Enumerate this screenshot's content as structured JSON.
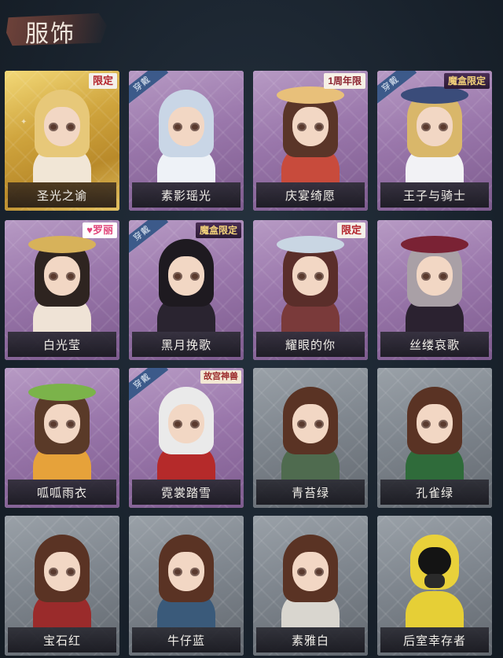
{
  "header": {
    "title": "服饰"
  },
  "outfits": [
    {
      "name": "圣光之谕",
      "frame": "gold",
      "badge_wear": "",
      "badge": "限定",
      "badge_style": "limited",
      "hair": "#e7c879",
      "body": "#f1e6d6",
      "hat": ""
    },
    {
      "name": "素影瑶光",
      "frame": "purple",
      "badge_wear": "穿戴",
      "badge": "",
      "badge_style": "",
      "hair": "#c9d6e6",
      "body": "#eef2f7",
      "hat": ""
    },
    {
      "name": "庆宴绮愿",
      "frame": "purple",
      "badge_wear": "",
      "badge": "1周年限",
      "badge_style": "anniv",
      "hair": "#5a3528",
      "body": "#c84b3c",
      "hat": "#e8c07a"
    },
    {
      "name": "王子与骑士",
      "frame": "gold-purple",
      "badge_wear": "穿戴",
      "badge": "魔盒限定",
      "badge_style": "box",
      "hair": "#d9b76a",
      "body": "#f2f2f5",
      "hat": "#3a4c7a"
    },
    {
      "name": "白光莹",
      "frame": "purple",
      "badge_wear": "",
      "badge": "♥罗丽",
      "badge_style": "love",
      "hair": "#2e2420",
      "body": "#efe3d6",
      "hat": "#d7b25a"
    },
    {
      "name": "黑月挽歌",
      "frame": "gold-purple",
      "badge_wear": "穿戴",
      "badge": "魔盒限定",
      "badge_style": "box",
      "hair": "#1e1a20",
      "body": "#2a2430",
      "hat": ""
    },
    {
      "name": "耀眼的你",
      "frame": "purple",
      "badge_wear": "",
      "badge": "限定",
      "badge_style": "limited",
      "hair": "#5a2e2a",
      "body": "#7a3a3a",
      "hat": "#c9d6e3"
    },
    {
      "name": "丝缕哀歌",
      "frame": "purple",
      "badge_wear": "",
      "badge": "",
      "badge_style": "",
      "hair": "#a9a0a6",
      "body": "#2b2230",
      "hat": "#7a2234"
    },
    {
      "name": "呱呱雨衣",
      "frame": "purple",
      "badge_wear": "",
      "badge": "",
      "badge_style": "",
      "hair": "#5a3a28",
      "body": "#e6a23a",
      "hat": "#7bb34a"
    },
    {
      "name": "霓裳踏雪",
      "frame": "gold-purple",
      "badge_wear": "穿戴",
      "badge": "故宫神兽",
      "badge_style": "beast",
      "hair": "#eaeaea",
      "body": "#b52a2a",
      "hat": ""
    },
    {
      "name": "青苔绿",
      "frame": "gray",
      "badge_wear": "",
      "badge": "",
      "badge_style": "",
      "hair": "#5a3324",
      "body": "#4f6b4f",
      "hat": ""
    },
    {
      "name": "孔雀绿",
      "frame": "gray",
      "badge_wear": "",
      "badge": "",
      "badge_style": "",
      "hair": "#5a3324",
      "body": "#2f6b3a",
      "hat": ""
    },
    {
      "name": "宝石红",
      "frame": "gray",
      "badge_wear": "",
      "badge": "",
      "badge_style": "",
      "hair": "#5a3324",
      "body": "#9a2b2b",
      "hat": ""
    },
    {
      "name": "牛仔蓝",
      "frame": "gray",
      "badge_wear": "",
      "badge": "",
      "badge_style": "",
      "hair": "#5a3324",
      "body": "#3a5a7a",
      "hat": ""
    },
    {
      "name": "素雅白",
      "frame": "gray",
      "badge_wear": "",
      "badge": "",
      "badge_style": "",
      "hair": "#5a3324",
      "body": "#d9d6cf",
      "hat": ""
    },
    {
      "name": "后室幸存者",
      "frame": "gray",
      "badge_wear": "",
      "badge": "",
      "badge_style": "",
      "hair": "",
      "body": "#e6cf36",
      "hat": "",
      "special": "hazmat"
    }
  ]
}
